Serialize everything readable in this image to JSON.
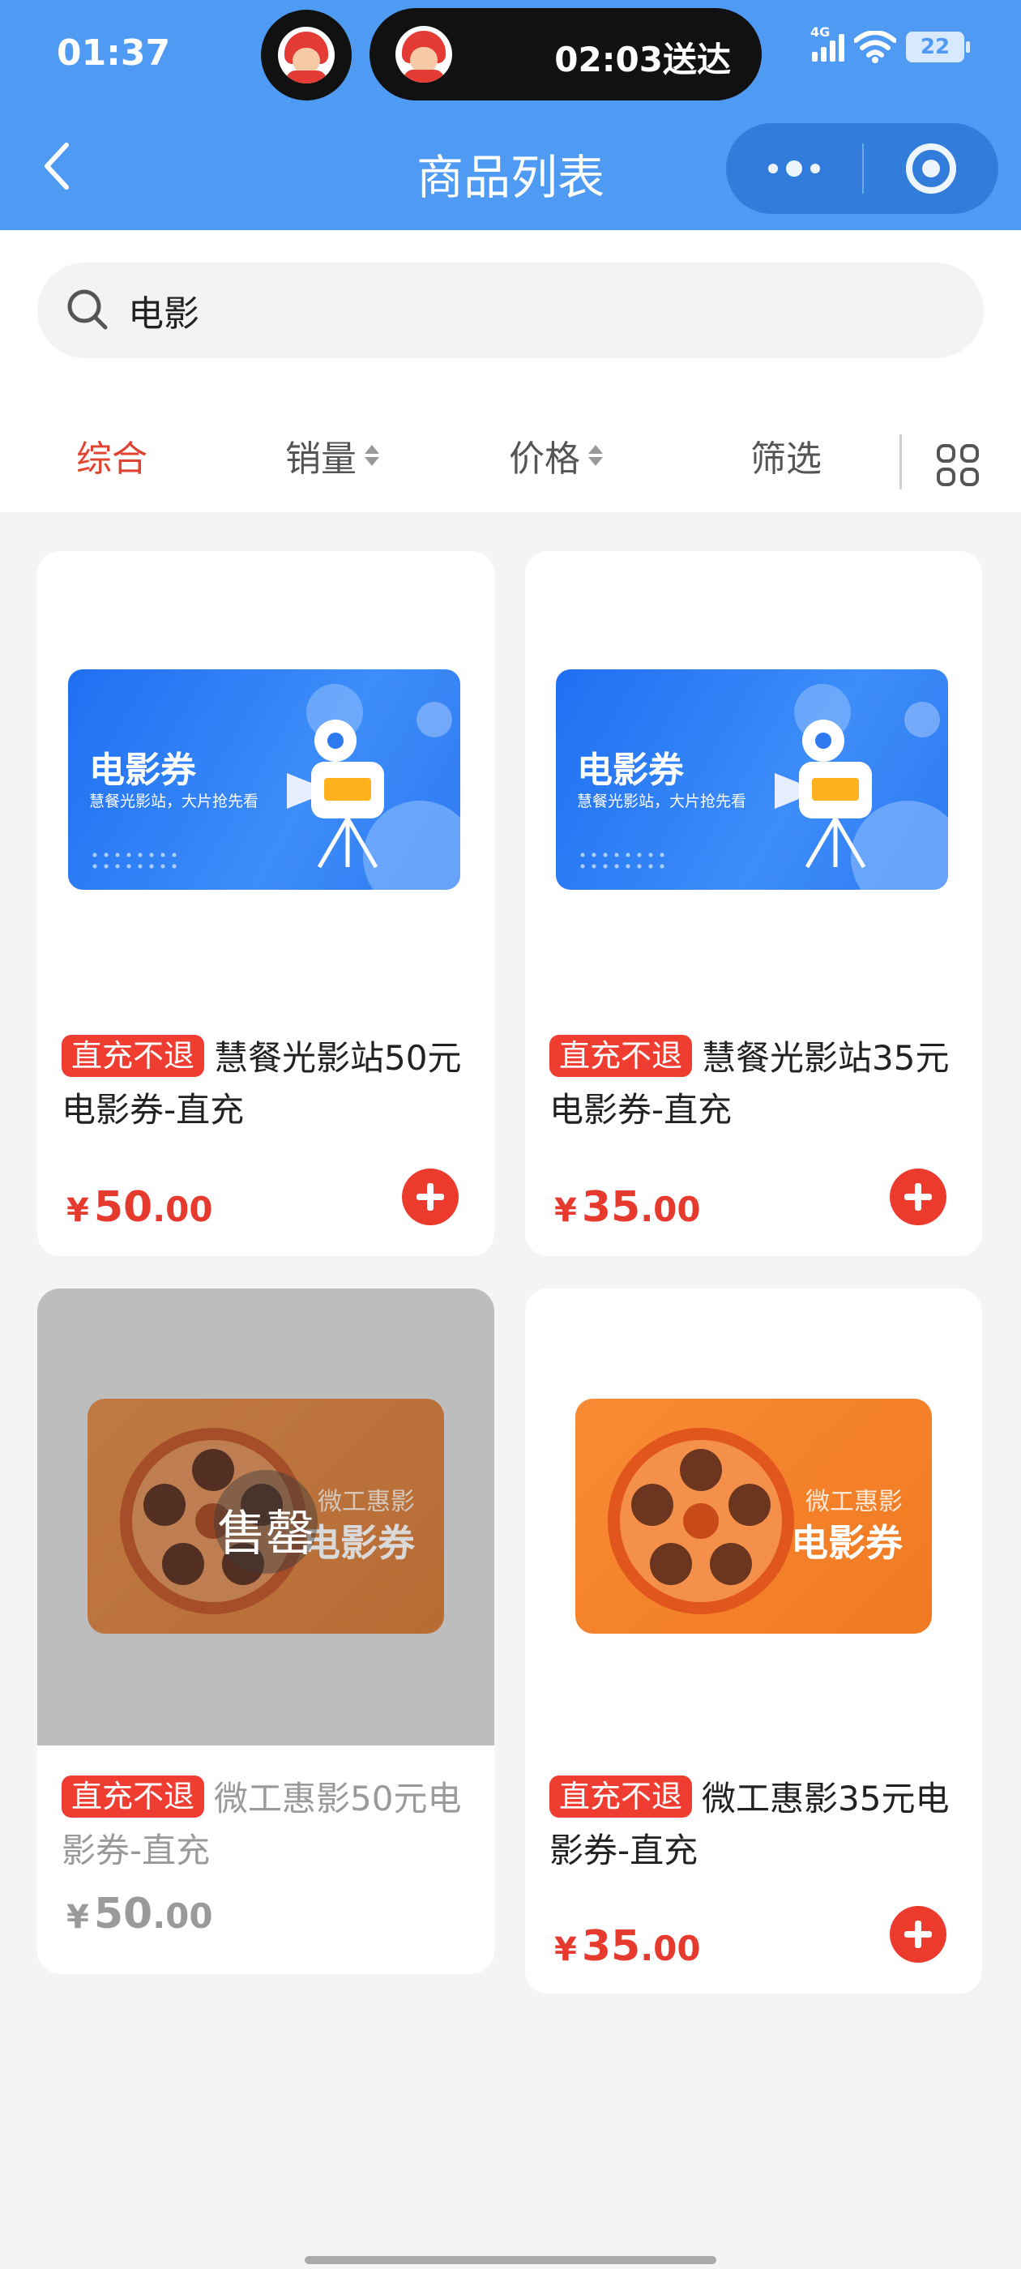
{
  "status_bar": {
    "time": "01:37",
    "island_text": "02:03送达",
    "network": "4G",
    "battery": "22"
  },
  "nav": {
    "title": "商品列表"
  },
  "search": {
    "value": "电影"
  },
  "filters": {
    "items": [
      {
        "label": "综合"
      },
      {
        "label": "销量"
      },
      {
        "label": "价格"
      },
      {
        "label": "筛选"
      }
    ]
  },
  "products": [
    {
      "tag": "直充不退",
      "name": "慧餐光影站50元电影券-直充",
      "banner_title": "电影券",
      "banner_subtitle": "慧餐光影站，大片抢先看",
      "price_symbol": "¥",
      "price_int": "50",
      "price_dec": ".00"
    },
    {
      "tag": "直充不退",
      "name": "慧餐光影站35元电影券-直充",
      "banner_title": "电影券",
      "banner_subtitle": "慧餐光影站，大片抢先看",
      "price_symbol": "¥",
      "price_int": "35",
      "price_dec": ".00"
    },
    {
      "tag": "直充不退",
      "name": "微工惠影50元电影券-直充",
      "banner_brand": "微工惠影",
      "banner_title": "电影券",
      "soldout_label": "售罄",
      "price_symbol": "¥",
      "price_int": "50",
      "price_dec": ".00"
    },
    {
      "tag": "直充不退",
      "name": "微工惠影35元电影券-直充",
      "banner_brand": "微工惠影",
      "banner_title": "电影券",
      "price_symbol": "¥",
      "price_int": "35",
      "price_dec": ".00"
    }
  ],
  "colors": {
    "header_blue": "#4f9af3",
    "accent_red": "#e0432f"
  }
}
